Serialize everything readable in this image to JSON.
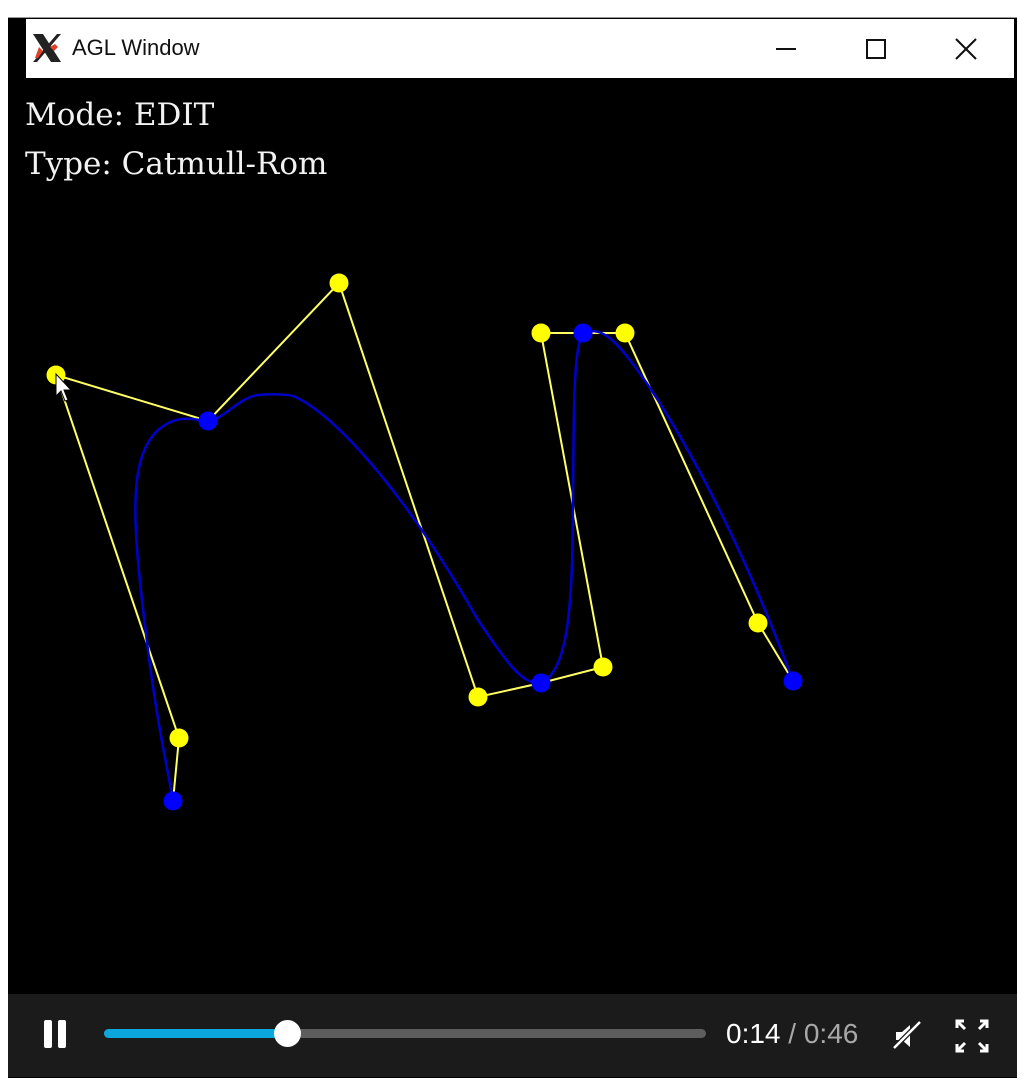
{
  "window": {
    "title": "AGL Window",
    "app_icon": "x11-logo-icon",
    "controls": [
      "minimize-icon",
      "maximize-icon",
      "close-icon"
    ]
  },
  "hud": {
    "mode": "Mode: EDIT",
    "type": "Type: Catmull-Rom"
  },
  "colors": {
    "background": "#000000",
    "control_point": "#ffff00",
    "control_polygon": "#ffff66",
    "curve": "#0000cc",
    "knot": "#0000ff",
    "progress": "#0aa6dc"
  },
  "player": {
    "current_time": "0:14",
    "separator": "/",
    "duration": "0:46",
    "progress": 0.304,
    "icons": [
      "pause-icon",
      "muted-speaker-icon",
      "fullscreen-icon"
    ]
  }
}
